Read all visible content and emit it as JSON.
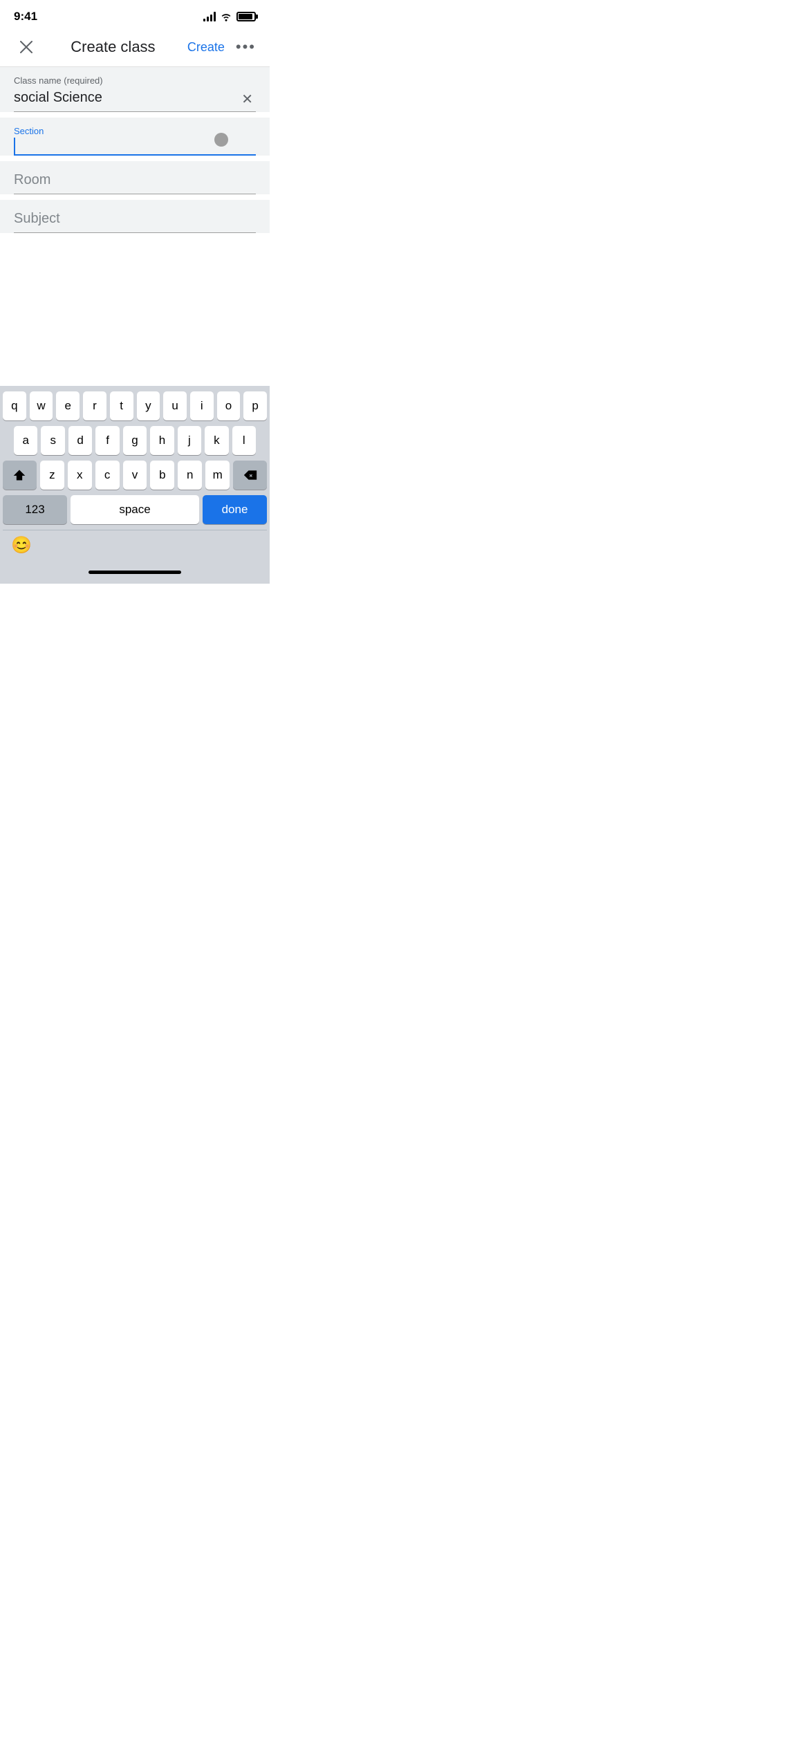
{
  "statusBar": {
    "time": "9:41"
  },
  "navBar": {
    "title": "Create class",
    "createLabel": "Create",
    "moreLabel": "•••"
  },
  "form": {
    "classNameLabel": "Class name (required)",
    "classNameValue": "social Science",
    "sectionLabel": "Section",
    "sectionValue": "",
    "roomLabel": "Room",
    "subjectLabel": "Subject"
  },
  "keyboard": {
    "row1": [
      "q",
      "w",
      "e",
      "r",
      "t",
      "y",
      "u",
      "i",
      "o",
      "p"
    ],
    "row2": [
      "a",
      "s",
      "d",
      "f",
      "g",
      "h",
      "j",
      "k",
      "l"
    ],
    "row3": [
      "z",
      "x",
      "c",
      "v",
      "b",
      "n",
      "m"
    ],
    "spaceLabel": "space",
    "doneLabel": "done",
    "numbersLabel": "123"
  }
}
